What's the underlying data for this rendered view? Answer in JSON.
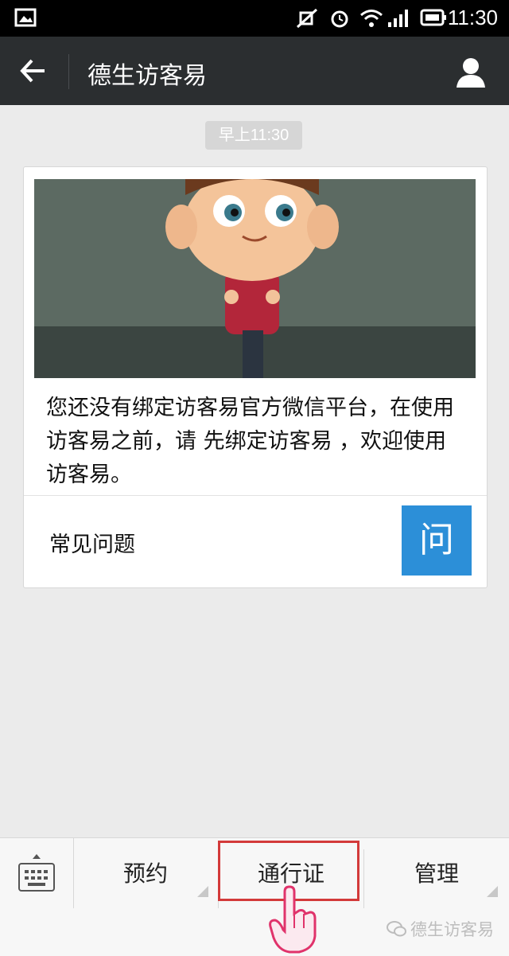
{
  "status_bar": {
    "time": "11:30",
    "icons": [
      "screenshot-icon",
      "mute-icon",
      "alarm-icon",
      "wifi-icon",
      "signal-icon",
      "battery-icon"
    ]
  },
  "header": {
    "title": "德生访客易",
    "back_icon": "back-arrow-icon",
    "profile_icon": "person-icon"
  },
  "chat": {
    "timestamp": "早上11:30",
    "card": {
      "message": "您还没有绑定访客易官方微信平台，在使用访客易之前，请 先绑定访客易 ，欢迎使用访客易。",
      "faq_label": "常见问题",
      "faq_icon_text": "问"
    }
  },
  "bottom_menu": {
    "keyboard_icon": "keyboard-icon",
    "items": [
      {
        "label": "预约"
      },
      {
        "label": "通行证"
      },
      {
        "label": "管理"
      }
    ]
  },
  "watermark": "德生访客易",
  "colors": {
    "title_bar": "#2b2e30",
    "faq_accent": "#2c8fd8",
    "highlight": "#d33a3a"
  }
}
